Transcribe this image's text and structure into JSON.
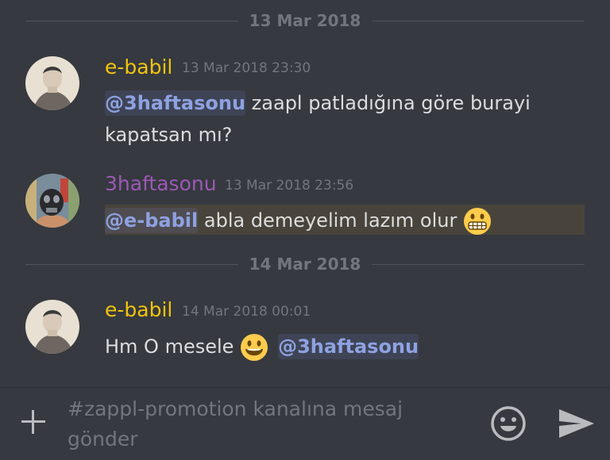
{
  "colors": {
    "background": "#36393f",
    "username_ebabil": "#f1c40f",
    "username_3haftasonu": "#9b59b6",
    "mention": "#8ea1e1",
    "muted": "#72767d"
  },
  "dividers": [
    "13 Mar 2018",
    "14 Mar 2018"
  ],
  "messages": [
    {
      "username": "e-babil",
      "timestamp": "13 Mar 2018 23:30",
      "mention": "@3haftasonu",
      "line1": " zaapl patladığına göre burayi",
      "line2": "kapatsan mı?"
    },
    {
      "username": "3haftasonu",
      "timestamp": "13 Mar 2018 23:56",
      "mention": "@e-babil",
      "text": " abla demeyelim lazım olur ",
      "emoji": "grimacing-emoji"
    },
    {
      "username": "e-babil",
      "timestamp": "14 Mar 2018 00:01",
      "text": "Hm O mesele ",
      "emoji": "smiley-emoji",
      "mention": "@3haftasonu"
    }
  ],
  "composer": {
    "placeholder_line1": "#zappl-promotion kanalına mesaj",
    "placeholder_line2": "gönder",
    "icons": [
      "plus-icon",
      "emoji-icon",
      "send-icon"
    ]
  }
}
